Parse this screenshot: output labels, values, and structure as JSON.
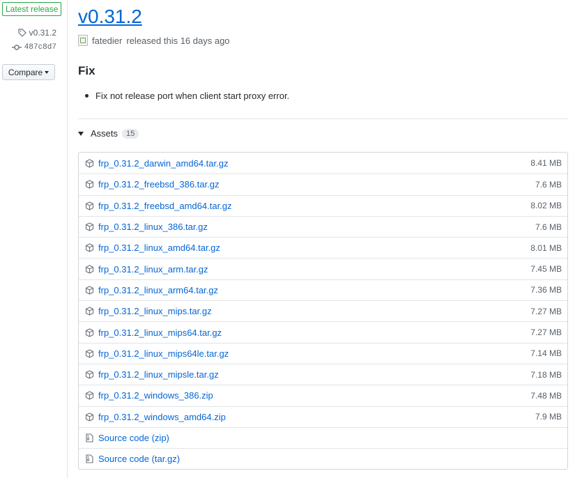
{
  "sidebar": {
    "badge": "Latest release",
    "tag": "v0.31.2",
    "commit": "487c8d7",
    "compare_label": "Compare"
  },
  "release": {
    "title": "v0.31.2",
    "author": "fatedier",
    "byline_rest": "released this 16 days ago",
    "heading": "Fix",
    "notes": [
      "Fix not release port when client start proxy error."
    ]
  },
  "assets": {
    "label": "Assets",
    "count": "15",
    "items": [
      {
        "name": "frp_0.31.2_darwin_amd64.tar.gz",
        "size": "8.41 MB",
        "icon": "package-icon"
      },
      {
        "name": "frp_0.31.2_freebsd_386.tar.gz",
        "size": "7.6 MB",
        "icon": "package-icon"
      },
      {
        "name": "frp_0.31.2_freebsd_amd64.tar.gz",
        "size": "8.02 MB",
        "icon": "package-icon"
      },
      {
        "name": "frp_0.31.2_linux_386.tar.gz",
        "size": "7.6 MB",
        "icon": "package-icon"
      },
      {
        "name": "frp_0.31.2_linux_amd64.tar.gz",
        "size": "8.01 MB",
        "icon": "package-icon"
      },
      {
        "name": "frp_0.31.2_linux_arm.tar.gz",
        "size": "7.45 MB",
        "icon": "package-icon"
      },
      {
        "name": "frp_0.31.2_linux_arm64.tar.gz",
        "size": "7.36 MB",
        "icon": "package-icon"
      },
      {
        "name": "frp_0.31.2_linux_mips.tar.gz",
        "size": "7.27 MB",
        "icon": "package-icon"
      },
      {
        "name": "frp_0.31.2_linux_mips64.tar.gz",
        "size": "7.27 MB",
        "icon": "package-icon"
      },
      {
        "name": "frp_0.31.2_linux_mips64le.tar.gz",
        "size": "7.14 MB",
        "icon": "package-icon"
      },
      {
        "name": "frp_0.31.2_linux_mipsle.tar.gz",
        "size": "7.18 MB",
        "icon": "package-icon"
      },
      {
        "name": "frp_0.31.2_windows_386.zip",
        "size": "7.48 MB",
        "icon": "package-icon"
      },
      {
        "name": "frp_0.31.2_windows_amd64.zip",
        "size": "7.9 MB",
        "icon": "package-icon"
      },
      {
        "name": "Source code (zip)",
        "size": "",
        "icon": "file-zip-icon"
      },
      {
        "name": "Source code (tar.gz)",
        "size": "",
        "icon": "file-zip-icon"
      }
    ]
  }
}
